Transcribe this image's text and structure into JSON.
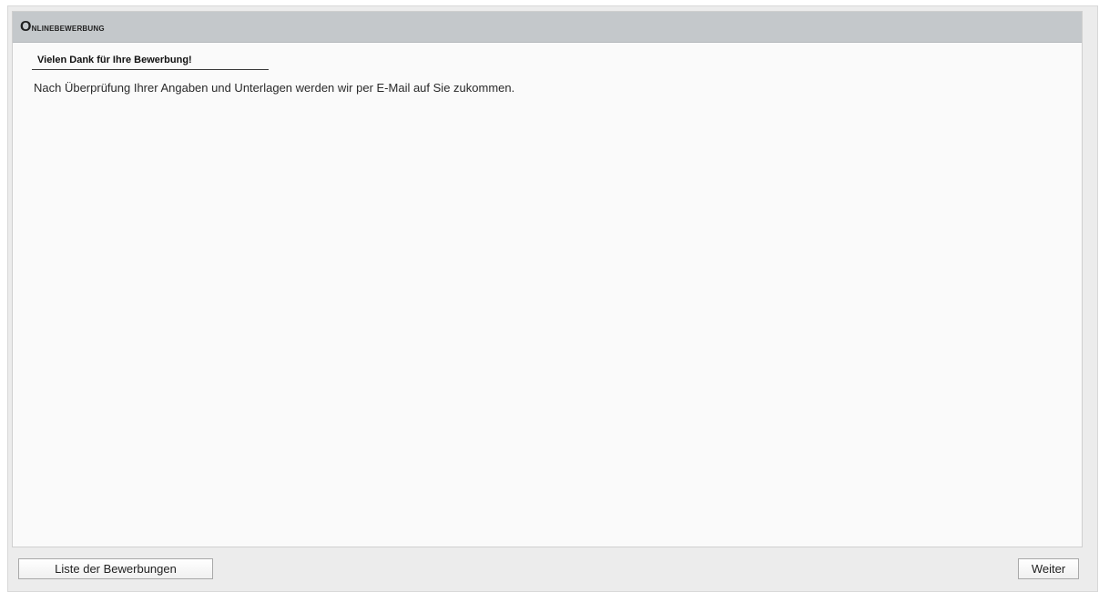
{
  "header": {
    "title_initial": "O",
    "title_rest": "NLINEBEWERBUNG"
  },
  "main": {
    "subheading": "Vielen Dank für Ihre Bewerbung!",
    "message": "Nach Überprüfung Ihrer Angaben und Unterlagen werden wir per E-Mail auf Sie zukommen."
  },
  "footer": {
    "list_button_label": "Liste der Bewerbungen",
    "next_button_label": "Weiter"
  }
}
